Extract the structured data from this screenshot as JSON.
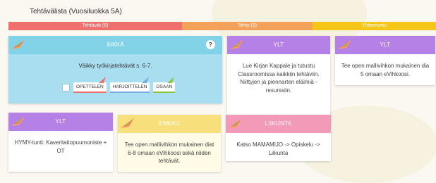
{
  "page": {
    "title": "Tehtävälista (Vuosiluokka 5A)"
  },
  "tabs": [
    {
      "label": "Tehtävät (6)"
    },
    {
      "label": "Tehty (2)"
    },
    {
      "label": "Yhteenveto"
    }
  ],
  "main_card": {
    "subject": "ÄIKKÄ",
    "help": "?",
    "text": "Väikky työkirjatehtävät s. 6-7.",
    "skills": [
      "OPETTELEN",
      "HARJOITTELEN",
      "OSAAN"
    ]
  },
  "cards": [
    {
      "subject": "YLT",
      "text": "Lue Kirjan Kappale ja tutustu Classroomissa kaikkiin tehtäviin. Niittyjen ja piennarten eläimiä -resurssiin."
    },
    {
      "subject": "YLT",
      "text": "Tee open mallivihkon mukainen dia 5 omaan eVihkoosi."
    },
    {
      "subject": "YLT",
      "text": "HYMY-tunti: Kaveritaitopuumoniste + OT"
    },
    {
      "subject": "ENKKU",
      "text": "Tee open mallivihkon mukainen diat 6-8 omaan eVihkoosi sekä niiden tehtävät."
    },
    {
      "subject": "LIIKUNTA",
      "text": "Katso MAMAMIJO -> Opiskelu -> Liikunta"
    }
  ],
  "colors": {
    "tab_tasks": "#ef6f6c",
    "tab_done": "#f4a259",
    "tab_summary": "#f5c518",
    "purple": "#b581e6",
    "yellow": "#f7e07b",
    "pink": "#f39ab8",
    "teal": "#82d3e8"
  },
  "icons": {
    "card_flag": "flag-icon",
    "help": "help-icon",
    "skill_marker": "triangle-icon"
  }
}
